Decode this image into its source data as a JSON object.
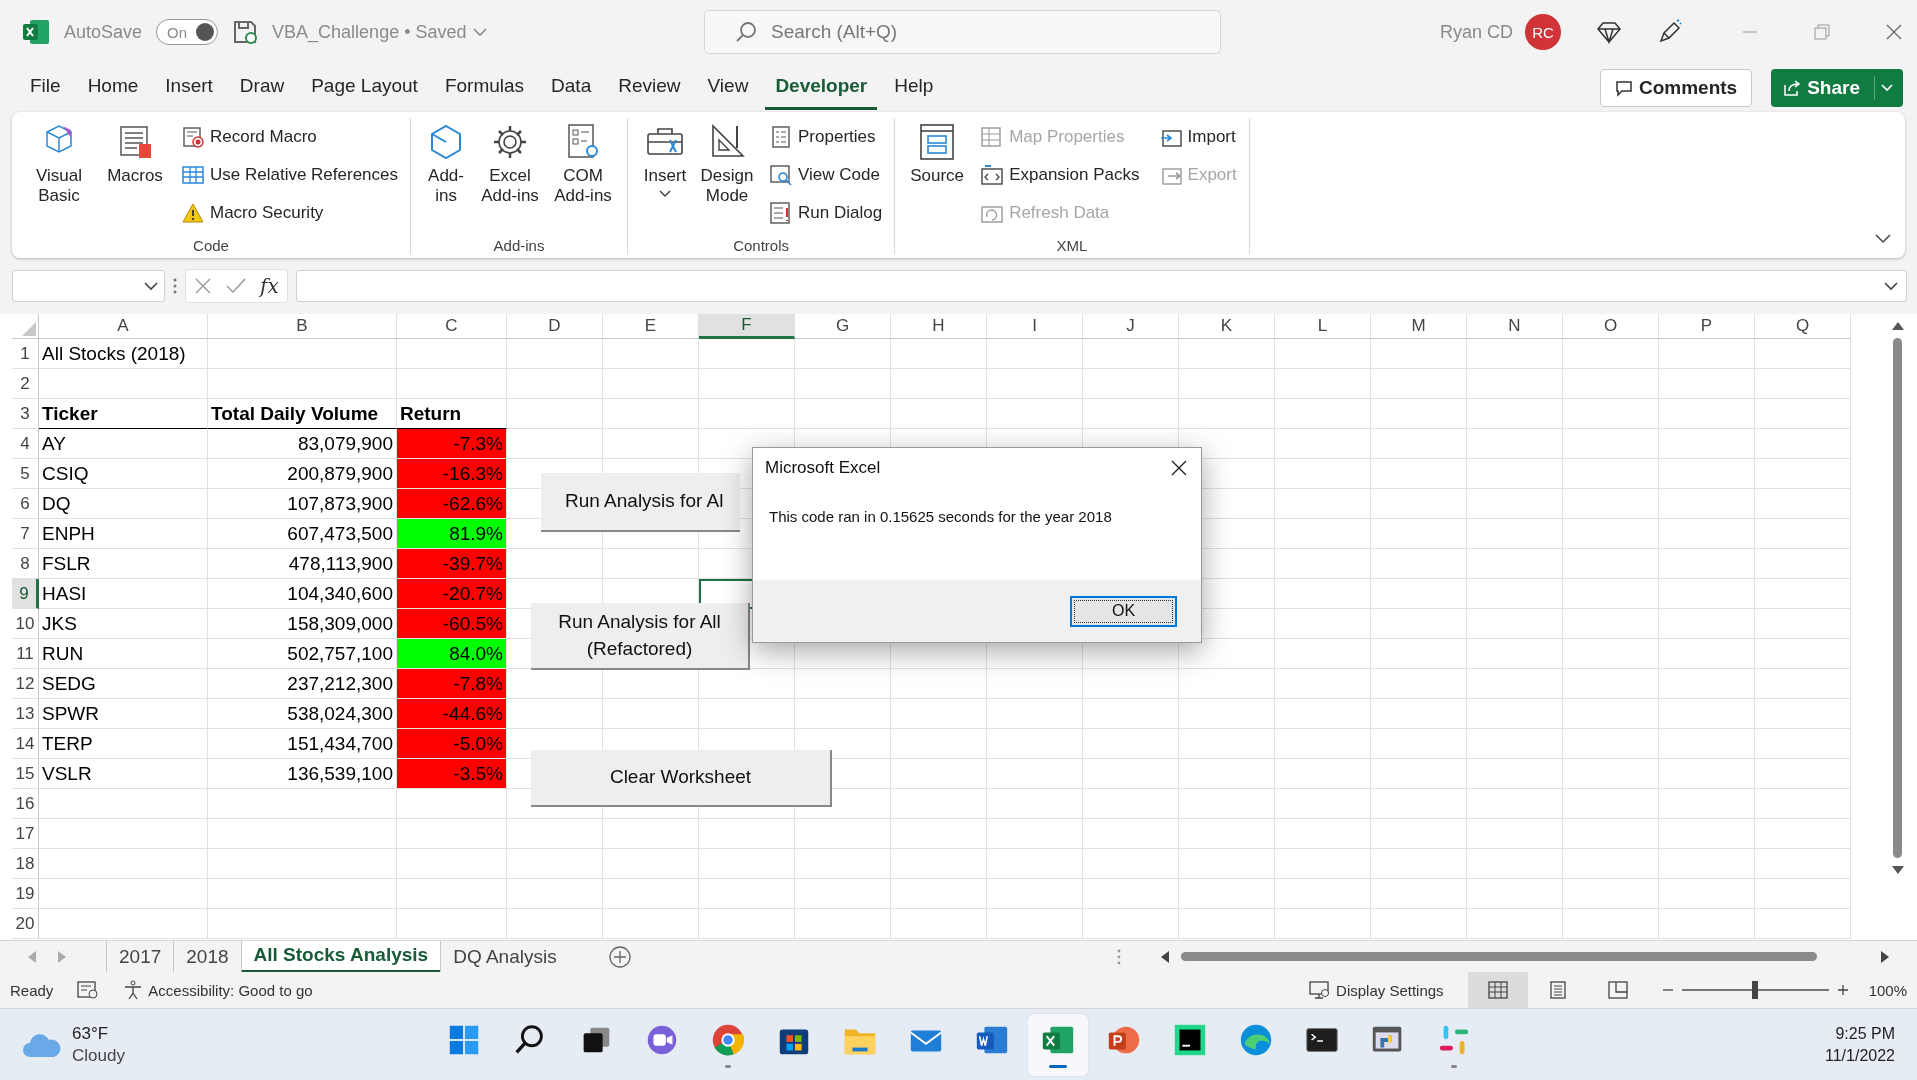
{
  "title_bar": {
    "autosave_label": "AutoSave",
    "autosave": {
      "on": true,
      "label": "On"
    },
    "document": "VBA_Challenge • Saved",
    "search_placeholder": "Search (Alt+Q)",
    "user": "Ryan CD",
    "avatar": "RC"
  },
  "menu_tabs": [
    {
      "label": "File",
      "selected": false
    },
    {
      "label": "Home",
      "selected": false
    },
    {
      "label": "Insert",
      "selected": false
    },
    {
      "label": "Draw",
      "selected": false
    },
    {
      "label": "Page Layout",
      "selected": false
    },
    {
      "label": "Formulas",
      "selected": false
    },
    {
      "label": "Data",
      "selected": false
    },
    {
      "label": "Review",
      "selected": false
    },
    {
      "label": "View",
      "selected": false
    },
    {
      "label": "Developer",
      "selected": true
    },
    {
      "label": "Help",
      "selected": false
    }
  ],
  "comments_button": "Comments",
  "share_button": "Share",
  "ribbon": [
    {
      "label": "Code",
      "items": [
        {
          "kind": "large",
          "label": "Visual Basic",
          "disabled": false
        },
        {
          "kind": "large",
          "label": "Macros",
          "disabled": false
        },
        {
          "kind": "small",
          "label": "Record Macro",
          "disabled": false
        },
        {
          "kind": "small",
          "label": "Use Relative References",
          "disabled": false
        },
        {
          "kind": "small",
          "label": "Macro Security",
          "disabled": false
        }
      ]
    },
    {
      "label": "Add-ins",
      "items": [
        {
          "kind": "large",
          "label": "Add-ins",
          "disabled": false
        },
        {
          "kind": "large",
          "label": "Excel Add-ins",
          "disabled": false
        },
        {
          "kind": "large",
          "label": "COM Add-ins",
          "disabled": false
        }
      ]
    },
    {
      "label": "Controls",
      "items": [
        {
          "kind": "large",
          "label": "Insert",
          "disabled": false
        },
        {
          "kind": "large",
          "label": "Design Mode",
          "disabled": false
        },
        {
          "kind": "small",
          "label": "Properties",
          "disabled": false
        },
        {
          "kind": "small",
          "label": "View Code",
          "disabled": false
        },
        {
          "kind": "small",
          "label": "Run Dialog",
          "disabled": false
        }
      ]
    },
    {
      "label": "XML",
      "items": [
        {
          "kind": "large",
          "label": "Source",
          "disabled": false
        },
        {
          "kind": "small",
          "label": "Map Properties",
          "disabled": true
        },
        {
          "kind": "small",
          "label": "Expansion Packs",
          "disabled": false
        },
        {
          "kind": "small",
          "label": "Refresh Data",
          "disabled": true
        },
        {
          "kind": "small",
          "label": "Import",
          "disabled": false
        },
        {
          "kind": "small",
          "label": "Export",
          "disabled": true
        }
      ]
    }
  ],
  "formula_bar": {
    "function_label": "fx"
  },
  "sheet": {
    "columns": [
      {
        "label": "A",
        "selected": false
      },
      {
        "label": "B",
        "selected": false
      },
      {
        "label": "C",
        "selected": false
      },
      {
        "label": "D",
        "selected": false
      },
      {
        "label": "E",
        "selected": false
      },
      {
        "label": "F",
        "selected": true
      },
      {
        "label": "G",
        "selected": false
      },
      {
        "label": "H",
        "selected": false
      },
      {
        "label": "I",
        "selected": false
      },
      {
        "label": "J",
        "selected": false
      },
      {
        "label": "K",
        "selected": false
      },
      {
        "label": "L",
        "selected": false
      },
      {
        "label": "M",
        "selected": false
      },
      {
        "label": "N",
        "selected": false
      },
      {
        "label": "O",
        "selected": false
      },
      {
        "label": "P",
        "selected": false
      },
      {
        "label": "Q",
        "selected": false
      }
    ],
    "rows": [
      {
        "number": "1",
        "selected": false,
        "cells": [
          {
            "text": "All Stocks (2018)",
            "bold": false
          }
        ]
      },
      {
        "number": "2",
        "selected": false,
        "cells": []
      },
      {
        "number": "3",
        "selected": false,
        "cells": [
          {
            "text": "Ticker",
            "bold": true
          },
          {
            "text": "Total Daily Volume",
            "bold": true
          },
          {
            "text": "Return",
            "bold": true
          }
        ]
      },
      {
        "number": "4",
        "selected": false,
        "cells": [
          {
            "text": "AY",
            "bold": false
          },
          {
            "text": "83,079,900",
            "bold": false
          },
          {
            "text": "-7.3%",
            "bold": false,
            "color": "#ff0000"
          }
        ]
      },
      {
        "number": "5",
        "selected": false,
        "cells": [
          {
            "text": "CSIQ",
            "bold": false
          },
          {
            "text": "200,879,900",
            "bold": false
          },
          {
            "text": "-16.3%",
            "bold": false,
            "color": "#ff0000"
          }
        ]
      },
      {
        "number": "6",
        "selected": false,
        "cells": [
          {
            "text": "DQ",
            "bold": false
          },
          {
            "text": "107,873,900",
            "bold": false
          },
          {
            "text": "-62.6%",
            "bold": false,
            "color": "#ff0000"
          }
        ]
      },
      {
        "number": "7",
        "selected": false,
        "cells": [
          {
            "text": "ENPH",
            "bold": false
          },
          {
            "text": "607,473,500",
            "bold": false
          },
          {
            "text": "81.9%",
            "bold": false,
            "color": "#00ff00"
          }
        ]
      },
      {
        "number": "8",
        "selected": false,
        "cells": [
          {
            "text": "FSLR",
            "bold": false
          },
          {
            "text": "478,113,900",
            "bold": false
          },
          {
            "text": "-39.7%",
            "bold": false,
            "color": "#ff0000"
          }
        ]
      },
      {
        "number": "9",
        "selected": true,
        "cells": [
          {
            "text": "HASI",
            "bold": false
          },
          {
            "text": "104,340,600",
            "bold": false
          },
          {
            "text": "-20.7%",
            "bold": false,
            "color": "#ff0000"
          }
        ]
      },
      {
        "number": "10",
        "selected": false,
        "cells": [
          {
            "text": "JKS",
            "bold": false
          },
          {
            "text": "158,309,000",
            "bold": false
          },
          {
            "text": "-60.5%",
            "bold": false,
            "color": "#ff0000"
          }
        ]
      },
      {
        "number": "11",
        "selected": false,
        "cells": [
          {
            "text": "RUN",
            "bold": false
          },
          {
            "text": "502,757,100",
            "bold": false
          },
          {
            "text": "84.0%",
            "bold": false,
            "color": "#00ff00"
          }
        ]
      },
      {
        "number": "12",
        "selected": false,
        "cells": [
          {
            "text": "SEDG",
            "bold": false
          },
          {
            "text": "237,212,300",
            "bold": false
          },
          {
            "text": "-7.8%",
            "bold": false,
            "color": "#ff0000"
          }
        ]
      },
      {
        "number": "13",
        "selected": false,
        "cells": [
          {
            "text": "SPWR",
            "bold": false
          },
          {
            "text": "538,024,300",
            "bold": false
          },
          {
            "text": "-44.6%",
            "bold": false,
            "color": "#ff0000"
          }
        ]
      },
      {
        "number": "14",
        "selected": false,
        "cells": [
          {
            "text": "TERP",
            "bold": false
          },
          {
            "text": "151,434,700",
            "bold": false
          },
          {
            "text": "-5.0%",
            "bold": false,
            "color": "#ff0000"
          }
        ]
      },
      {
        "number": "15",
        "selected": false,
        "cells": [
          {
            "text": "VSLR",
            "bold": false
          },
          {
            "text": "136,539,100",
            "bold": false
          },
          {
            "text": "-3.5%",
            "bold": false,
            "color": "#ff0000"
          }
        ]
      },
      {
        "number": "16",
        "selected": false,
        "cells": []
      },
      {
        "number": "17",
        "selected": false,
        "cells": []
      },
      {
        "number": "18",
        "selected": false,
        "cells": []
      },
      {
        "number": "19",
        "selected": false,
        "cells": []
      },
      {
        "number": "20",
        "selected": false,
        "cells": []
      }
    ],
    "buttons": [
      {
        "label": "Run Analysis for Al"
      },
      {
        "label": "Run Analysis for All (Refactored)"
      },
      {
        "label": "Clear Worksheet"
      }
    ]
  },
  "dialog": {
    "title": "Microsoft Excel",
    "message": "This code ran in 0.15625 seconds for the year 2018",
    "ok": "OK"
  },
  "sheet_tabs": [
    {
      "label": "2017",
      "selected": false
    },
    {
      "label": "2018",
      "selected": false
    },
    {
      "label": "All Stocks Analysis",
      "selected": true
    },
    {
      "label": "DQ Analysis",
      "selected": false
    }
  ],
  "status_bar": {
    "status": "Ready",
    "accessibility": "Accessibility: Good to go",
    "display_settings": "Display Settings",
    "views": [
      {
        "selected": true
      },
      {
        "selected": false
      },
      {
        "selected": false
      }
    ],
    "zoom": {
      "level": 0.5
    },
    "zoom_label": "100%"
  },
  "taskbar": {
    "temperature": "63°F",
    "condition": "Cloudy",
    "apps": [
      {
        "running": false,
        "active": false
      },
      {
        "running": false,
        "active": false
      },
      {
        "running": false,
        "active": false
      },
      {
        "running": false,
        "active": false
      },
      {
        "running": true,
        "active": false
      },
      {
        "running": false,
        "active": false
      },
      {
        "running": false,
        "active": false
      },
      {
        "running": false,
        "active": false
      },
      {
        "running": false,
        "active": false
      },
      {
        "running": true,
        "active": true
      },
      {
        "running": false,
        "active": false
      },
      {
        "running": false,
        "active": false
      },
      {
        "running": false,
        "active": false
      },
      {
        "running": false,
        "active": false
      },
      {
        "running": false,
        "active": false
      },
      {
        "running": true,
        "active": false
      }
    ],
    "time": "9:25 PM",
    "date": "11/1/2022"
  }
}
